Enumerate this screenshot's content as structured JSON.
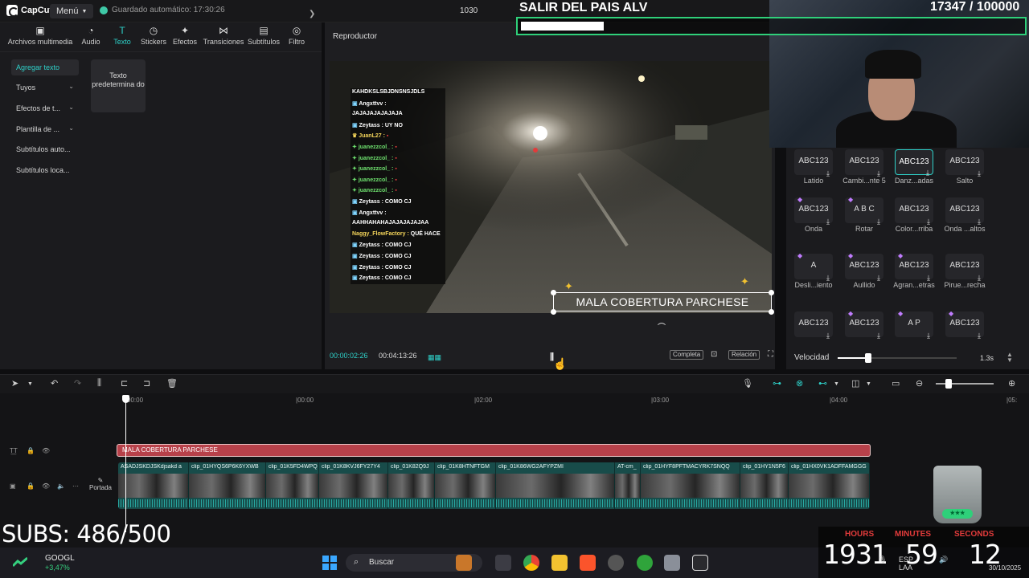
{
  "app": {
    "name": "CapCut",
    "menu_label": "Menú",
    "autosave": "Guardado automático: 17:30:26",
    "project_name": "1030"
  },
  "stream_goal": {
    "title": "SALIR DEL PAIS ALV",
    "count": "17347",
    "total": "/ 100000",
    "progress_fraction": 0.17347
  },
  "tabs": [
    {
      "label": "Archivos multimedia",
      "icon": "media-icon"
    },
    {
      "label": "Audio",
      "icon": "audio-icon"
    },
    {
      "label": "Texto",
      "icon": "text-icon"
    },
    {
      "label": "Stickers",
      "icon": "stickers-icon"
    },
    {
      "label": "Efectos",
      "icon": "effects-icon"
    },
    {
      "label": "Transiciones",
      "icon": "transitions-icon"
    },
    {
      "label": "Subtítulos",
      "icon": "subtitles-icon"
    },
    {
      "label": "Filtro",
      "icon": "filters-icon"
    }
  ],
  "sidebar": {
    "items": [
      {
        "label": "Agregar texto",
        "has_chevron": false,
        "active": true
      },
      {
        "label": "Tuyos",
        "has_chevron": true
      },
      {
        "label": "Efectos de t...",
        "has_chevron": true
      },
      {
        "label": "Plantilla de ...",
        "has_chevron": true
      },
      {
        "label": "Subtítulos auto...",
        "has_chevron": false
      },
      {
        "label": "Subtítulos loca...",
        "has_chevron": false
      }
    ],
    "default_text_card": "Texto predetermina do"
  },
  "player": {
    "title": "Reproductor",
    "time_current": "00:00:02:26",
    "time_total": "00:04:13:26",
    "caption": "MALA COBERTURA PARCHESE",
    "btn_full": "Completa",
    "btn_ratio": "Relación"
  },
  "chat": [
    {
      "user": "",
      "msg": "KAHDKSLSBJDNSNSJDLS",
      "icon": ""
    },
    {
      "user": "Angxttvv :",
      "msg": "",
      "icon": "u"
    },
    {
      "user": "",
      "msg": "JAJAJAJAJAJAJA",
      "icon": ""
    },
    {
      "user": "Zeytass :",
      "msg": "UY NO",
      "icon": "u"
    },
    {
      "user": "JuanL27 :",
      "msg": "▪",
      "icon": "y"
    },
    {
      "user": "juanezzcol_ :",
      "msg": "▪",
      "icon": "g"
    },
    {
      "user": "juanezzcol_ :",
      "msg": "▪",
      "icon": "g"
    },
    {
      "user": "juanezzcol_ :",
      "msg": "▪",
      "icon": "g"
    },
    {
      "user": "juanezzcol_ :",
      "msg": "▪",
      "icon": "g"
    },
    {
      "user": "juanezzcol_ :",
      "msg": "▪",
      "icon": "g"
    },
    {
      "user": "Zeytass :",
      "msg": "COMO CJ",
      "icon": "u"
    },
    {
      "user": "Angxttvv :",
      "msg": "",
      "icon": "u"
    },
    {
      "user": "",
      "msg": "AAHHAHAHAJAJAJAJAJAA",
      "icon": ""
    },
    {
      "user": "Naggy_FlowFactory :",
      "msg": "QUÉ HACE",
      "icon": ""
    },
    {
      "user": "Zeytass :",
      "msg": "COMO CJ",
      "icon": "u"
    },
    {
      "user": "Zeytass :",
      "msg": "COMO CJ",
      "icon": "u"
    },
    {
      "user": "Zeytass :",
      "msg": "COMO CJ",
      "icon": "u"
    },
    {
      "user": "Zeytass :",
      "msg": "COMO CJ",
      "icon": "u"
    }
  ],
  "animations": [
    {
      "sample": "ABC123",
      "label": "Latido",
      "vip": false
    },
    {
      "sample": "ABC123",
      "label": "Cambi...nte 5",
      "vip": false
    },
    {
      "sample": "ABC123",
      "label": "Danz...adas",
      "vip": false,
      "selected": true
    },
    {
      "sample": "ABC123",
      "label": "Salto",
      "vip": false
    },
    {
      "sample": "ABC123",
      "label": "Onda",
      "vip": true
    },
    {
      "sample": "A B C",
      "label": "Rotar",
      "vip": true
    },
    {
      "sample": "ABC123",
      "label": "Color...rriba",
      "vip": false
    },
    {
      "sample": "ABC123",
      "label": "Onda ...altos",
      "vip": false
    },
    {
      "sample": "A",
      "label": "Desli...iento",
      "vip": true
    },
    {
      "sample": "ABC123",
      "label": "Aullido",
      "vip": true
    },
    {
      "sample": "ABC123",
      "label": "Agran...etras",
      "vip": true
    },
    {
      "sample": "ABC123",
      "label": "Pirue...recha",
      "vip": false
    },
    {
      "sample": "ABC123",
      "label": "",
      "vip": false
    },
    {
      "sample": "ABC123",
      "label": "",
      "vip": true
    },
    {
      "sample": "A P",
      "label": "",
      "vip": true
    },
    {
      "sample": "ABC123",
      "label": "",
      "vip": true
    }
  ],
  "speed": {
    "label": "Velocidad",
    "value": "1.3s",
    "fraction": 0.26
  },
  "timeline": {
    "ruler": [
      "00:00",
      "|00:00",
      "|02:00",
      "|03:00",
      "|04:00",
      "|05:"
    ],
    "text_clip": "MALA COBERTURA PARCHESE",
    "portada": "Portada",
    "clips": [
      "ASADJSKDJSKdjsakd a",
      "clip_01HYQS6P6K6YXWB",
      "clip_01K5FD4WPQ",
      "clip_01K8KVJ6FY27Y4",
      "clip_01K82Q9J",
      "clip_01K8HTNFTGM",
      "clip_01K86WG2AFYPZMI",
      "AT-cm_",
      "clip_01HYF8PFTMACYRK7SNQQ",
      "clip_01HY1N5F6",
      "clip_01HX0VK1ADFFAMGGG"
    ]
  },
  "overlays": {
    "subs": "SUBS: 486/500",
    "timer": {
      "hours_label": "HOURS",
      "minutes_label": "MINUTES",
      "seconds_label": "SECONDS",
      "hours": "1931",
      "minutes": "59",
      "seconds": "12"
    }
  },
  "taskbar": {
    "stock_name": "GOOGL",
    "stock_change": "+3,47%",
    "search_label": "Buscar",
    "lang": "ESP",
    "lang_sub": "LAA",
    "date": "30/10/2025"
  },
  "colors": {
    "accent": "#2ed0c8",
    "text_clip": "#b7414a",
    "goal_border": "#2fd07a",
    "timer_label": "#e23b3b"
  }
}
